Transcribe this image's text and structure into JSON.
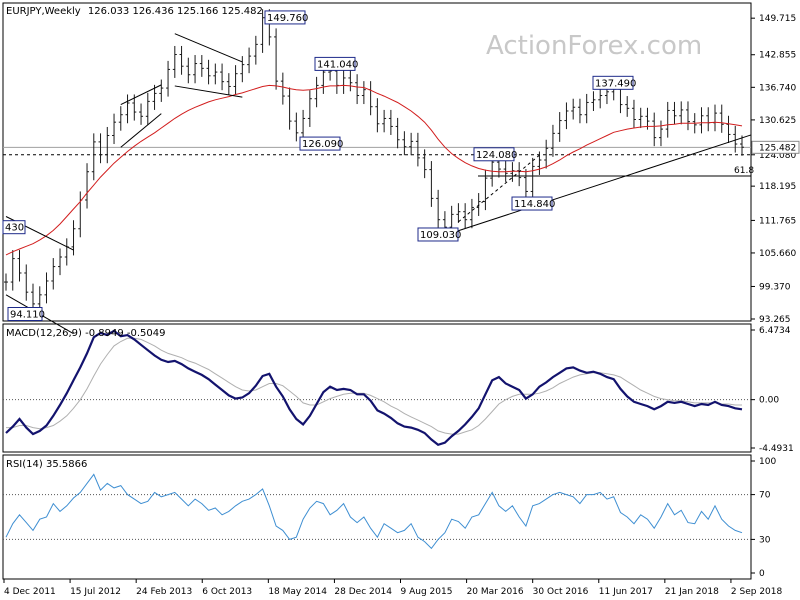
{
  "chart_data": {
    "type": "line",
    "symbol_label": "EURJPY,Weekly",
    "ohlc_label": "126.033 126.436 125.166 125.482",
    "watermark": "ActionForex.com",
    "x_tick_labels": [
      "4 Dec 2011",
      "15 Jul 2012",
      "24 Feb 2013",
      "6 Oct 2013",
      "18 May 2014",
      "28 Dec 2014",
      "9 Aug 2015",
      "20 Mar 2016",
      "30 Oct 2016",
      "11 Jun 2017",
      "21 Jan 2018",
      "2 Sep 2018"
    ],
    "price_axis_ticks": [
      "149.715",
      "142.855",
      "136.740",
      "130.625",
      "124.080",
      "118.195",
      "111.765",
      "105.660",
      "99.370",
      "93.265"
    ],
    "price_ylim": [
      93.265,
      152.0
    ],
    "current_price_label": "125.482",
    "price_callouts": [
      {
        "label": "149.760",
        "value": 149.76
      },
      {
        "label": "141.040",
        "value": 141.04
      },
      {
        "label": "126.090",
        "value": 126.09
      },
      {
        "label": "137.490",
        "value": 137.49
      },
      {
        "label": "124.080",
        "value": 124.08
      },
      {
        "label": "114.840",
        "value": 114.84
      },
      {
        "label": "109.030",
        "value": 109.03
      },
      {
        "label": "94.110",
        "value": 94.11
      },
      {
        "label": "430",
        "value": 110.4
      }
    ],
    "horizontal_levels": [
      {
        "label": "124.080",
        "value": 124.08,
        "style": "dashed"
      },
      {
        "label": "61.8",
        "value": 120.1,
        "style": "solid"
      }
    ],
    "price_close": [
      100.2,
      104.6,
      101.9,
      98.3,
      96.1,
      97.8,
      100.4,
      103.1,
      104.9,
      106.8,
      110.2,
      115.6,
      120.9,
      126.5,
      124.1,
      127.7,
      130.2,
      131.6,
      133.8,
      132.1,
      131.3,
      134.1,
      135.6,
      136.6,
      140.1,
      142.9,
      140.7,
      139.1,
      141.2,
      140.3,
      138.9,
      139.6,
      137.8,
      136.9,
      139.3,
      141.0,
      142.6,
      144.8,
      149.8,
      146.2,
      137.9,
      135.1,
      130.4,
      128.2,
      130.9,
      134.6,
      137.1,
      139.6,
      139.8,
      137.1,
      138.5,
      137.6,
      135.2,
      136.3,
      133.1,
      129.9,
      130.9,
      129.4,
      126.9,
      125.6,
      126.6,
      123.5,
      121.3,
      115.9,
      111.9,
      110.5,
      112.9,
      113.4,
      111.9,
      114.2,
      115.3,
      119.7,
      122.7,
      121.4,
      120.6,
      121.1,
      119.8,
      117.2,
      121.9,
      123.1,
      125.3,
      128.1,
      130.5,
      132.3,
      133.0,
      131.6,
      133.9,
      134.4,
      135.2,
      135.9,
      136.4,
      133.5,
      132.8,
      130.7,
      131.3,
      130.4,
      127.3,
      128.9,
      132.4,
      131.4,
      132.5,
      130.3,
      129.7,
      131.4,
      130.1,
      131.9,
      129.8,
      127.9,
      126.1,
      125.5
    ],
    "price_ma": [
      105.3,
      105.9,
      106.4,
      106.9,
      107.4,
      108.1,
      108.9,
      109.9,
      111.1,
      112.5,
      113.9,
      115.3,
      116.9,
      118.4,
      119.9,
      121.2,
      122.5,
      123.6,
      124.7,
      125.7,
      126.6,
      127.4,
      128.2,
      129.1,
      130.0,
      130.9,
      131.7,
      132.4,
      133.0,
      133.5,
      134.0,
      134.4,
      134.7,
      135.0,
      135.4,
      135.7,
      136.1,
      136.5,
      136.9,
      137.1,
      137.0,
      136.8,
      136.5,
      136.3,
      136.2,
      136.3,
      136.5,
      136.8,
      137.0,
      137.0,
      137.1,
      137.0,
      136.8,
      136.7,
      136.2,
      135.6,
      135.1,
      134.5,
      133.9,
      133.1,
      132.3,
      131.3,
      130.2,
      128.7,
      127.0,
      125.5,
      124.3,
      123.4,
      122.6,
      122.0,
      121.5,
      121.2,
      121.0,
      120.9,
      120.9,
      121.0,
      121.0,
      120.9,
      121.1,
      121.4,
      121.8,
      122.4,
      123.1,
      123.9,
      124.6,
      125.2,
      125.9,
      126.5,
      127.1,
      127.7,
      128.3,
      128.6,
      128.9,
      129.1,
      129.3,
      129.4,
      129.4,
      129.5,
      129.7,
      129.8,
      130.0,
      130.0,
      130.0,
      130.1,
      130.1,
      130.2,
      130.1,
      129.9,
      129.7,
      129.5
    ],
    "macd": {
      "title": "MACD(12,26,9) -0.8949 -0.5049",
      "axis_ticks": [
        "6.4734",
        "0.00",
        "-4.4931"
      ],
      "ylim": [
        -4.4931,
        6.4734
      ],
      "macd_line": [
        -3.1,
        -2.5,
        -1.8,
        -2.6,
        -3.2,
        -2.9,
        -2.4,
        -1.5,
        -0.5,
        0.6,
        1.8,
        3.0,
        4.3,
        5.8,
        6.2,
        6.0,
        6.4,
        5.9,
        6.0,
        5.6,
        5.1,
        4.6,
        4.1,
        3.7,
        3.5,
        3.6,
        3.3,
        2.9,
        2.6,
        2.3,
        1.9,
        1.4,
        0.9,
        0.4,
        0.1,
        0.2,
        0.6,
        1.3,
        2.2,
        2.4,
        1.2,
        0.3,
        -0.9,
        -1.8,
        -2.3,
        -1.5,
        -0.4,
        0.7,
        1.2,
        0.9,
        1.0,
        0.9,
        0.5,
        0.5,
        -0.1,
        -1.0,
        -1.3,
        -1.7,
        -2.2,
        -2.5,
        -2.6,
        -2.8,
        -3.1,
        -3.7,
        -4.2,
        -4.0,
        -3.4,
        -2.9,
        -2.3,
        -1.6,
        -0.8,
        0.5,
        1.8,
        2.1,
        1.5,
        1.2,
        0.9,
        0.1,
        0.5,
        1.2,
        1.6,
        2.1,
        2.5,
        2.9,
        3.0,
        2.7,
        2.5,
        2.6,
        2.4,
        2.1,
        1.9,
        1.0,
        0.3,
        -0.2,
        -0.4,
        -0.6,
        -0.9,
        -0.6,
        -0.2,
        -0.3,
        -0.2,
        -0.4,
        -0.6,
        -0.4,
        -0.5,
        -0.2,
        -0.5,
        -0.6,
        -0.8,
        -0.9
      ],
      "signal_line": [
        -2.6,
        -2.6,
        -2.4,
        -2.4,
        -2.6,
        -2.7,
        -2.6,
        -2.4,
        -2.0,
        -1.5,
        -0.8,
        0.0,
        1.0,
        2.2,
        3.3,
        4.2,
        5.0,
        5.4,
        5.7,
        5.7,
        5.6,
        5.3,
        5.0,
        4.6,
        4.3,
        4.1,
        3.9,
        3.6,
        3.4,
        3.1,
        2.8,
        2.4,
        2.0,
        1.6,
        1.2,
        0.9,
        0.8,
        0.9,
        1.2,
        1.5,
        1.5,
        1.3,
        0.8,
        0.3,
        -0.3,
        -0.5,
        -0.5,
        -0.2,
        0.1,
        0.3,
        0.5,
        0.6,
        0.6,
        0.6,
        0.4,
        0.1,
        -0.2,
        -0.6,
        -0.9,
        -1.3,
        -1.6,
        -1.9,
        -2.2,
        -2.5,
        -2.9,
        -3.1,
        -3.2,
        -3.2,
        -3.0,
        -2.8,
        -2.4,
        -1.8,
        -1.1,
        -0.4,
        0.0,
        0.3,
        0.5,
        0.5,
        0.5,
        0.6,
        0.8,
        1.1,
        1.5,
        1.8,
        2.1,
        2.3,
        2.4,
        2.5,
        2.5,
        2.4,
        2.3,
        2.1,
        1.7,
        1.3,
        0.9,
        0.6,
        0.3,
        0.1,
        0.0,
        -0.1,
        -0.1,
        -0.2,
        -0.3,
        -0.3,
        -0.3,
        -0.3,
        -0.4,
        -0.4,
        -0.5,
        -0.5
      ]
    },
    "rsi": {
      "title": "RSI(14) 35.5866",
      "axis_ticks": [
        "100",
        "70",
        "30",
        "0"
      ],
      "levels": [
        70,
        30
      ],
      "ylim": [
        0,
        100
      ],
      "values": [
        32,
        44,
        52,
        45,
        38,
        48,
        50,
        62,
        55,
        60,
        67,
        72,
        80,
        88,
        74,
        80,
        76,
        78,
        70,
        66,
        62,
        64,
        72,
        68,
        70,
        72,
        66,
        60,
        66,
        62,
        56,
        58,
        52,
        55,
        60,
        64,
        66,
        70,
        75,
        60,
        42,
        38,
        30,
        32,
        48,
        58,
        64,
        62,
        52,
        56,
        62,
        50,
        45,
        50,
        40,
        32,
        44,
        40,
        36,
        38,
        44,
        32,
        28,
        22,
        30,
        36,
        48,
        46,
        40,
        50,
        52,
        62,
        72,
        60,
        55,
        60,
        50,
        42,
        60,
        62,
        66,
        70,
        72,
        70,
        68,
        62,
        70,
        70,
        72,
        66,
        68,
        54,
        50,
        44,
        52,
        48,
        40,
        50,
        62,
        52,
        56,
        45,
        44,
        55,
        48,
        60,
        48,
        42,
        38,
        36
      ]
    }
  }
}
